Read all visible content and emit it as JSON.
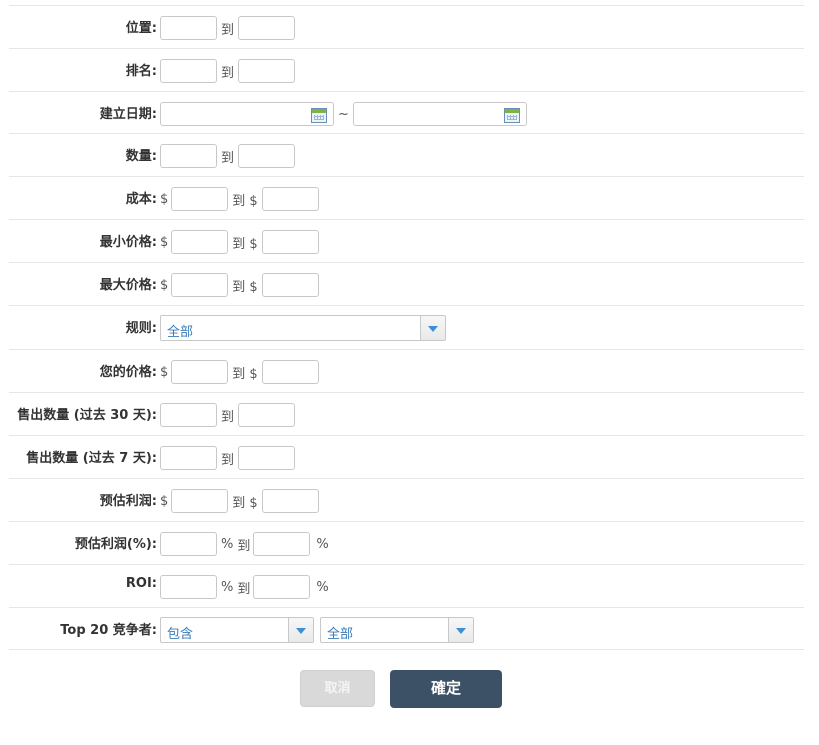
{
  "rows": {
    "position": {
      "label": "位置:",
      "to": "到"
    },
    "rank": {
      "label": "排名:",
      "to": "到"
    },
    "created_date": {
      "label": "建立日期:",
      "sep": "~"
    },
    "quantity": {
      "label": "数量:",
      "to": "到"
    },
    "cost": {
      "label": "成本:",
      "cur": "$",
      "to": "到 $"
    },
    "min_price": {
      "label": "最小价格:",
      "cur": "$",
      "to": "到 $"
    },
    "max_price": {
      "label": "最大价格:",
      "cur": "$",
      "to": "到 $"
    },
    "rule": {
      "label": "规则:",
      "selected": "全部"
    },
    "your_price": {
      "label": "您的价格:",
      "cur": "$",
      "to": "到 $"
    },
    "sold_30": {
      "label": "售出数量 (过去 30 天):",
      "to": "到"
    },
    "sold_7": {
      "label": "售出数量 (过去 7 天):",
      "to": "到"
    },
    "est_profit": {
      "label": "预估利润:",
      "cur": "$",
      "to": "到 $"
    },
    "est_profit_pct": {
      "label": "预估利润(%):",
      "pct": "%",
      "to": "到",
      "pct2": "%"
    },
    "roi": {
      "label": "ROI:",
      "pct": "%",
      "to": "到",
      "pct2": "%"
    },
    "top20": {
      "label": "Top 20 竞争者:",
      "mode": "包含",
      "selected": "全部"
    }
  },
  "buttons": {
    "cancel": "取消",
    "confirm": "確定"
  }
}
